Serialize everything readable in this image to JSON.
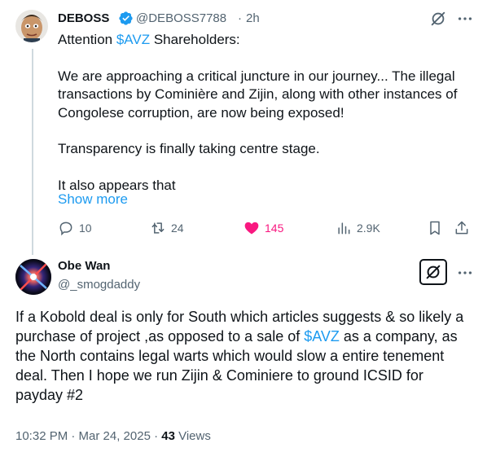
{
  "tweet1": {
    "display_name": "DEBOSS",
    "handle": "@DEBOSS7788",
    "separator": "·",
    "time": "2h",
    "line1_prefix": "Attention ",
    "line1_cashtag": "$AVZ",
    "line1_suffix": " Shareholders:",
    "paragraph2": "We are approaching a critical juncture in our journey... The illegal transactions by Cominière and Zijin, along with other instances of Congolese corruption, are now being exposed!",
    "paragraph3": "Transparency is finally taking centre stage.",
    "paragraph4": "It also appears that",
    "show_more": "Show more",
    "replies": "10",
    "reposts": "24",
    "likes": "145",
    "views": "2.9K"
  },
  "tweet2": {
    "display_name": "Obe Wan",
    "handle": "@_smogdaddy",
    "text_prefix": "If a Kobold deal is only for South which articles suggests & so likely a purchase of project ,as opposed to a sale of ",
    "text_cashtag": "$AVZ",
    "text_suffix": " as a company, as the North contains legal warts which would slow a entire tenement deal. Then I hope we run Zijin & Cominiere to ground ICSID for payday #2",
    "timestamp": "10:32 PM · Mar 24, 2025 · ",
    "views_count": "43",
    "views_label": " Views"
  },
  "colors": {
    "accent": "#1d9bf0",
    "like": "#f91880",
    "secondary_text": "#536471"
  },
  "icons": [
    "verified-badge-icon",
    "grok-icon",
    "more-icon",
    "reply-icon",
    "repost-icon",
    "like-icon",
    "views-icon",
    "bookmark-icon",
    "share-icon"
  ]
}
